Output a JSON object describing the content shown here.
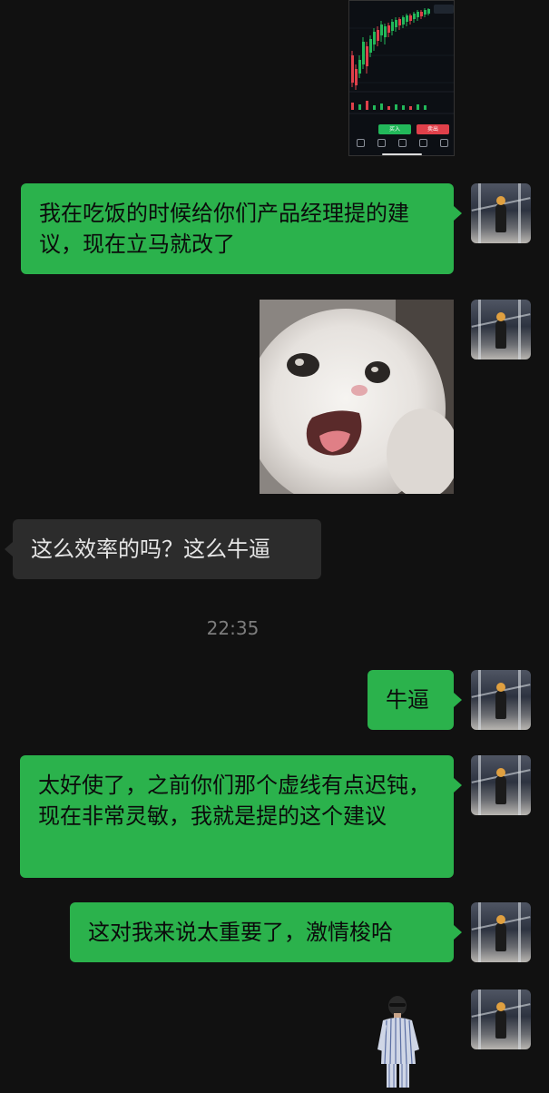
{
  "screenshot": {
    "buy_label": "买入",
    "sell_label": "卖出"
  },
  "messages": [
    {
      "text": "我在吃饭的时候给你们产品经理提的建议，现在立马就改了"
    },
    {
      "text": "这么效率的吗？这么牛逼"
    },
    {
      "text": "牛逼"
    },
    {
      "text": "太好使了，之前你们那个虚线有点迟钝，现在非常灵敏，我就是提的这个建议"
    },
    {
      "text": "这对我来说太重要了，激情梭哈"
    }
  ],
  "timestamp": "22:35",
  "colors": {
    "background": "#111111",
    "sent_bubble": "#2bb24c",
    "received_bubble": "#2c2c2c",
    "timestamp_text": "#7c7c7c"
  }
}
